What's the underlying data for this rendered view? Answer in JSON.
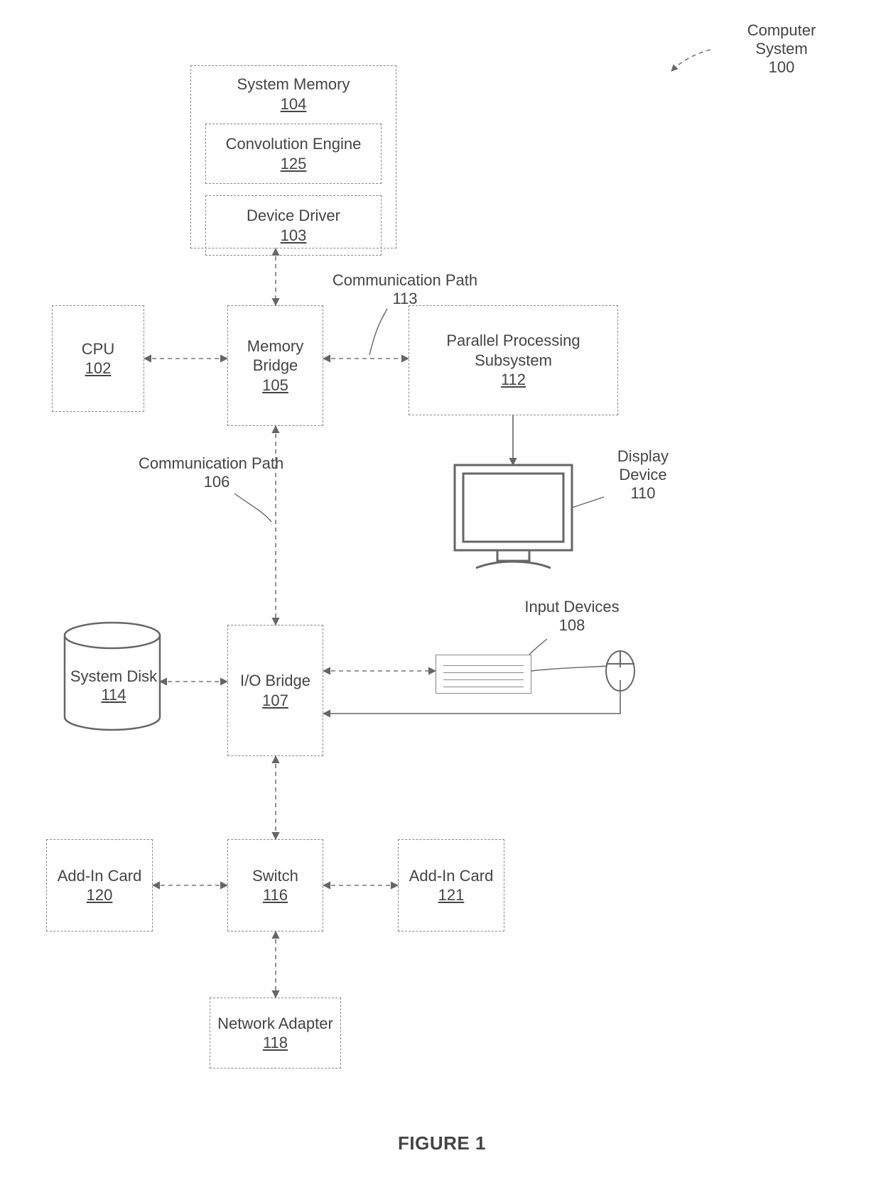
{
  "title": {
    "figure": "FIGURE 1"
  },
  "labels": {
    "computer_system": "Computer System",
    "computer_system_ref": "100",
    "comm_path_113": "Communication Path",
    "comm_path_113_ref": "113",
    "comm_path_106": "Communication Path",
    "comm_path_106_ref": "106",
    "display_device": "Display Device",
    "display_device_ref": "110",
    "input_devices": "Input Devices",
    "input_devices_ref": "108"
  },
  "blocks": {
    "system_memory": {
      "name": "System Memory",
      "ref": "104"
    },
    "conv_engine": {
      "name": "Convolution Engine",
      "ref": "125"
    },
    "device_driver": {
      "name": "Device Driver",
      "ref": "103"
    },
    "cpu": {
      "name": "CPU",
      "ref": "102"
    },
    "memory_bridge": {
      "name": "Memory Bridge",
      "ref": "105"
    },
    "pps": {
      "name": "Parallel Processing Subsystem",
      "ref": "112"
    },
    "system_disk": {
      "name": "System Disk",
      "ref": "114"
    },
    "io_bridge": {
      "name": "I/O Bridge",
      "ref": "107"
    },
    "switch": {
      "name": "Switch",
      "ref": "116"
    },
    "addin_left": {
      "name": "Add-In Card",
      "ref": "120"
    },
    "addin_right": {
      "name": "Add-In Card",
      "ref": "121"
    },
    "net_adapter": {
      "name": "Network Adapter",
      "ref": "118"
    }
  }
}
